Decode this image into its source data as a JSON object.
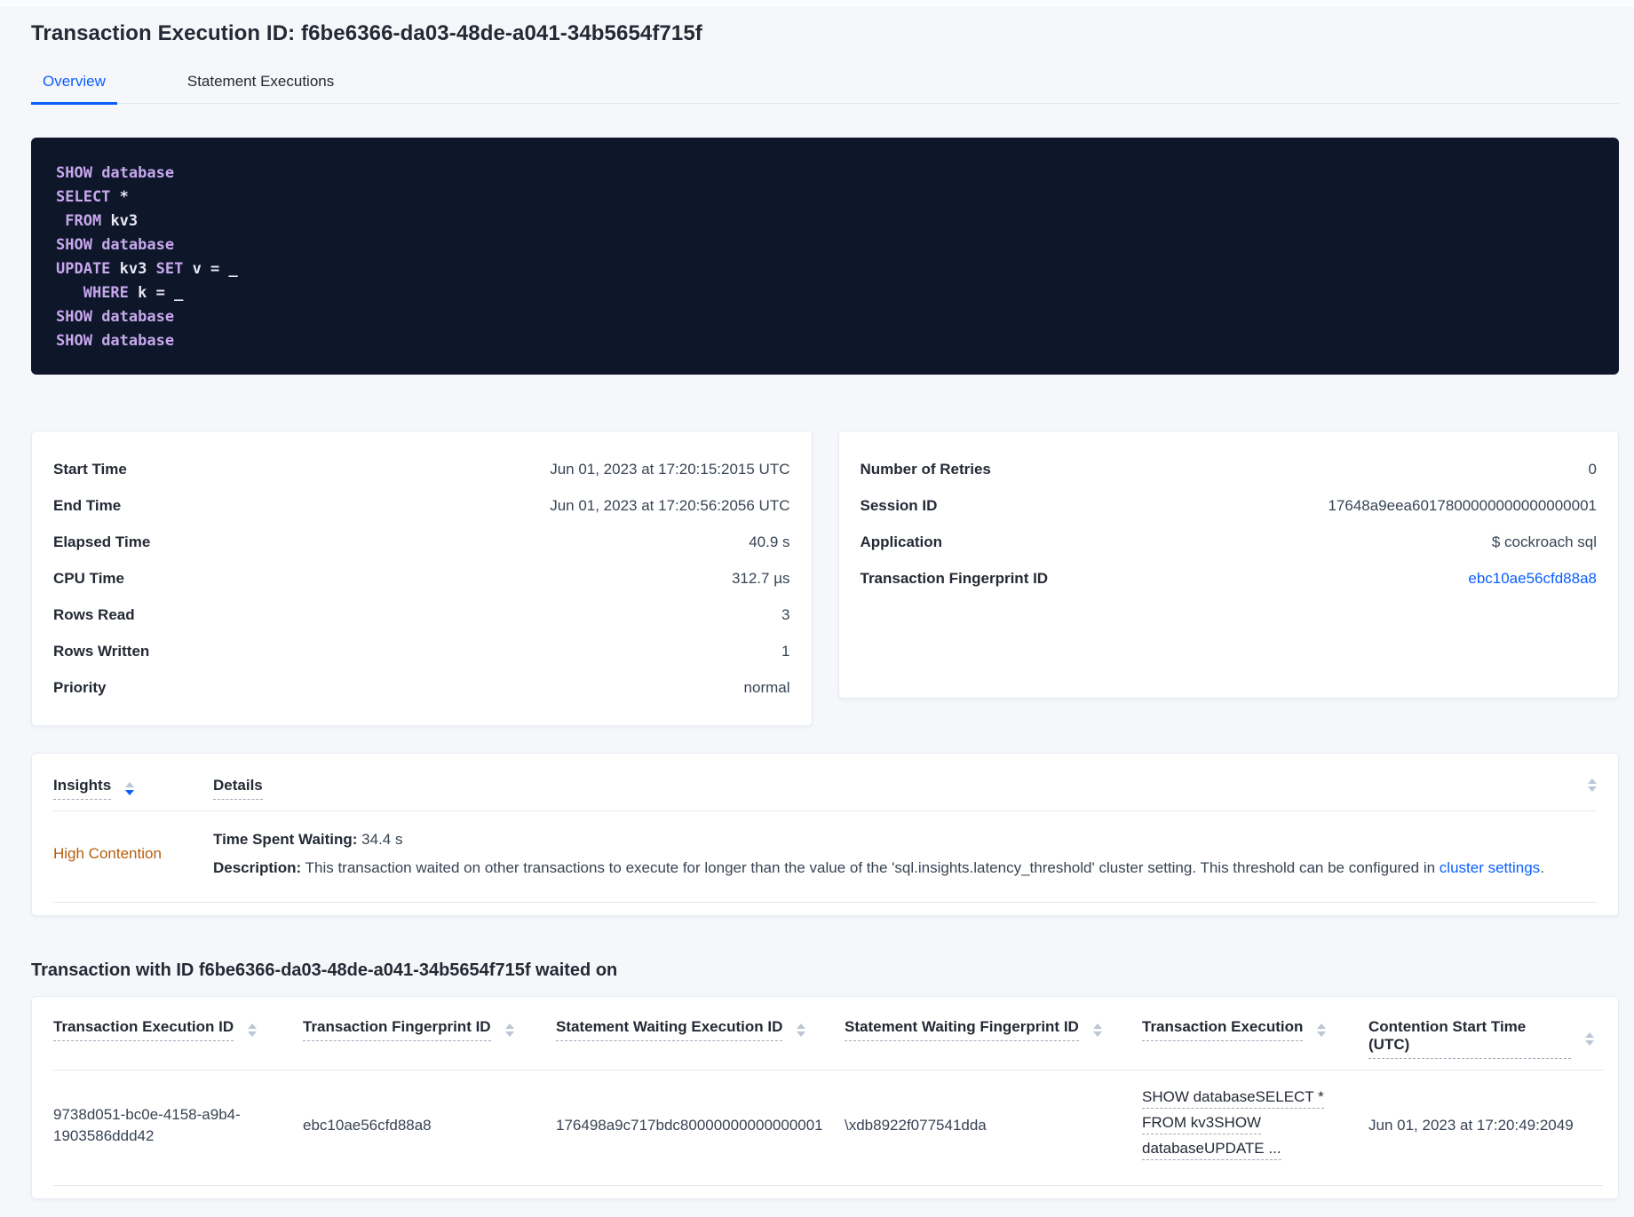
{
  "header": {
    "title": "Transaction Execution ID: f6be6366-da03-48de-a041-34b5654f715f",
    "tabs": [
      {
        "label": "Overview",
        "active": true
      },
      {
        "label": "Statement Executions",
        "active": false
      }
    ]
  },
  "sql": {
    "lines": [
      {
        "tokens": [
          {
            "text": "SHOW ",
            "type": "kw"
          },
          {
            "text": "database",
            "type": "kw"
          }
        ]
      },
      {
        "tokens": [
          {
            "text": "SELECT ",
            "type": "kw"
          },
          {
            "text": "*",
            "type": "id"
          }
        ]
      },
      {
        "tokens": [
          {
            "text": " ",
            "type": "id"
          },
          {
            "text": "FROM ",
            "type": "kw"
          },
          {
            "text": "kv3",
            "type": "id"
          }
        ]
      },
      {
        "tokens": [
          {
            "text": "SHOW ",
            "type": "kw"
          },
          {
            "text": "database",
            "type": "kw"
          }
        ]
      },
      {
        "tokens": [
          {
            "text": "UPDATE ",
            "type": "kw"
          },
          {
            "text": "kv3 ",
            "type": "id"
          },
          {
            "text": "SET ",
            "type": "kw"
          },
          {
            "text": "v = _",
            "type": "id"
          }
        ]
      },
      {
        "tokens": [
          {
            "text": "   ",
            "type": "id"
          },
          {
            "text": "WHERE ",
            "type": "kw"
          },
          {
            "text": "k = _",
            "type": "id"
          }
        ]
      },
      {
        "tokens": [
          {
            "text": "SHOW ",
            "type": "kw"
          },
          {
            "text": "database",
            "type": "kw"
          }
        ]
      },
      {
        "tokens": [
          {
            "text": "SHOW ",
            "type": "kw"
          },
          {
            "text": "database",
            "type": "kw"
          }
        ]
      }
    ]
  },
  "summary_left": {
    "rows": [
      {
        "label": "Start Time",
        "value": "Jun 01, 2023 at 17:20:15:2015 UTC"
      },
      {
        "label": "End Time",
        "value": "Jun 01, 2023 at 17:20:56:2056 UTC"
      },
      {
        "label": "Elapsed Time",
        "value": "40.9 s"
      },
      {
        "label": "CPU Time",
        "value": "312.7 µs"
      },
      {
        "label": "Rows Read",
        "value": "3"
      },
      {
        "label": "Rows Written",
        "value": "1"
      },
      {
        "label": "Priority",
        "value": "normal"
      }
    ]
  },
  "summary_right": {
    "rows": [
      {
        "label": "Number of Retries",
        "value": "0"
      },
      {
        "label": "Session ID",
        "value": "17648a9eea6017800000000000000001"
      },
      {
        "label": "Application",
        "value": "$ cockroach sql"
      },
      {
        "label": "Transaction Fingerprint ID",
        "value": "ebc10ae56cfd88a8",
        "link": true
      }
    ]
  },
  "insights": {
    "columns": [
      "Insights",
      "Details"
    ],
    "row": {
      "insight": "High Contention",
      "waiting_label": "Time Spent Waiting:",
      "waiting_value": " 34.4 s",
      "description_label": "Description:",
      "description_text": " This transaction waited on other transactions to execute for longer than the value of the 'sql.insights.latency_threshold' cluster setting. This threshold can be configured in ",
      "description_link": "cluster settings",
      "description_suffix": "."
    }
  },
  "waited_on": {
    "heading": "Transaction with ID f6be6366-da03-48de-a041-34b5654f715f waited on",
    "columns": [
      "Transaction Execution ID",
      "Transaction Fingerprint ID",
      "Statement Waiting Execution ID",
      "Statement Waiting Fingerprint ID",
      "Transaction Execution",
      "Contention Start Time (UTC)"
    ],
    "rows": [
      {
        "transaction_execution_id": "9738d051-bc0e-4158-a9b4-1903586ddd42",
        "transaction_fingerprint_id": "ebc10ae56cfd88a8",
        "statement_waiting_execution_id": "176498a9c717bdc80000000000000001",
        "statement_waiting_fingerprint_id": "\\xdb8922f077541dda",
        "transaction_execution_lines": [
          "SHOW databaseSELECT *",
          "FROM kv3SHOW",
          "databaseUPDATE ..."
        ],
        "contention_start_time": "Jun 01, 2023 at 17:20:49:2049"
      }
    ]
  },
  "colors": {
    "accent_blue": "#0b5fff",
    "high_contention_orange": "#b75d0b",
    "sql_box_background": "#0d1729",
    "sql_keyword": "#c8a7ee",
    "sql_identifier": "#e9e7f4",
    "page_background": "#f5f7fa"
  }
}
